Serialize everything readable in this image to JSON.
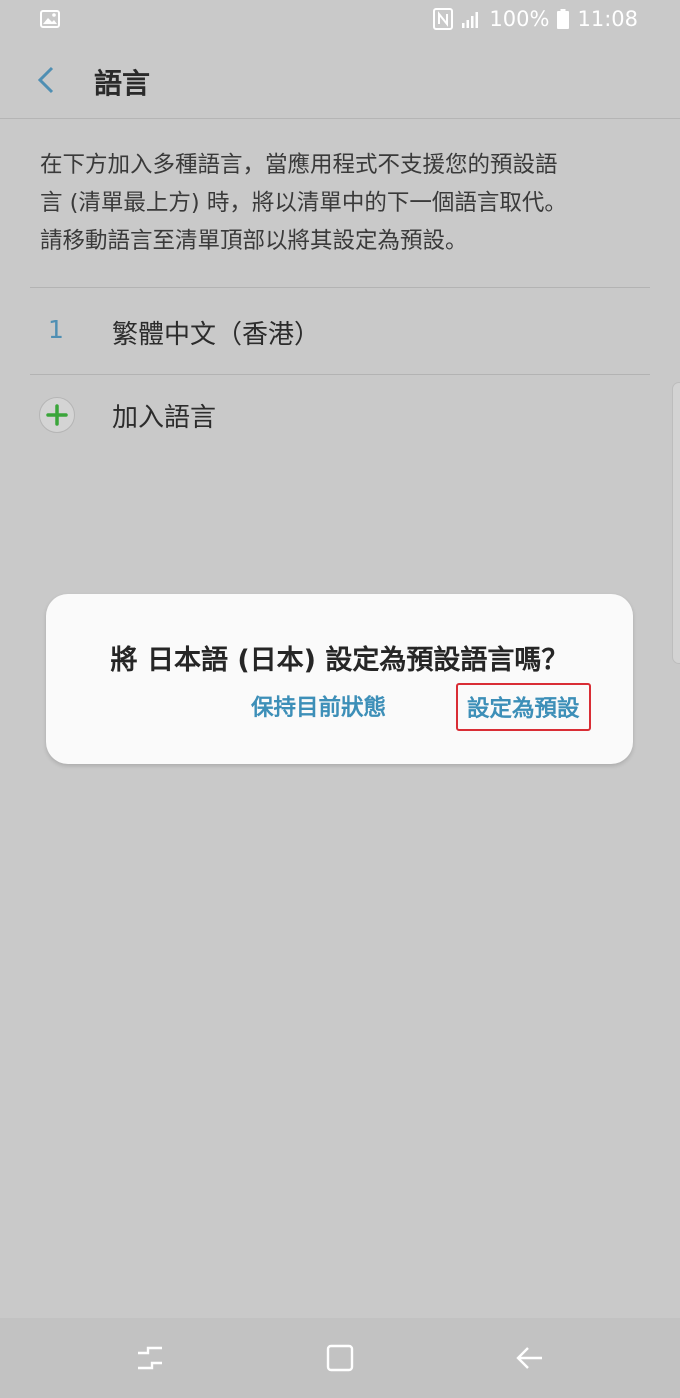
{
  "statusbar": {
    "battery": "100%",
    "time": "11:08",
    "icons": [
      "image-notification-icon",
      "nfc-icon",
      "signal-icon",
      "battery-icon"
    ]
  },
  "appbar": {
    "title": "語言",
    "back_icon": "chevron-left-icon"
  },
  "description": {
    "lines": [
      "在下方加入多種語言，當應用程式不支援您的預設語",
      "言 (清單最上方) 時，將以清單中的下一個語言取代。",
      "請移動語言至清單頂部以將其設定為預設。"
    ]
  },
  "languages": [
    {
      "index": "1",
      "name": "繁體中文（香港）"
    }
  ],
  "add_language": {
    "label": "加入語言",
    "icon": "plus-circle-icon"
  },
  "dialog": {
    "message": "將 日本語 (日本) 設定為預設語言嗎？",
    "keep_label": "保持目前狀態",
    "set_label": "設定為預設"
  },
  "navbar": {
    "icons": [
      "recents-icon",
      "home-icon",
      "back-icon"
    ]
  },
  "colors": {
    "accent": "#3d8fb8",
    "index_color": "#4f8fb3",
    "add_green": "#3aa53a",
    "highlight_red": "#d92d35",
    "scrim_background": "#c9c9c9"
  }
}
